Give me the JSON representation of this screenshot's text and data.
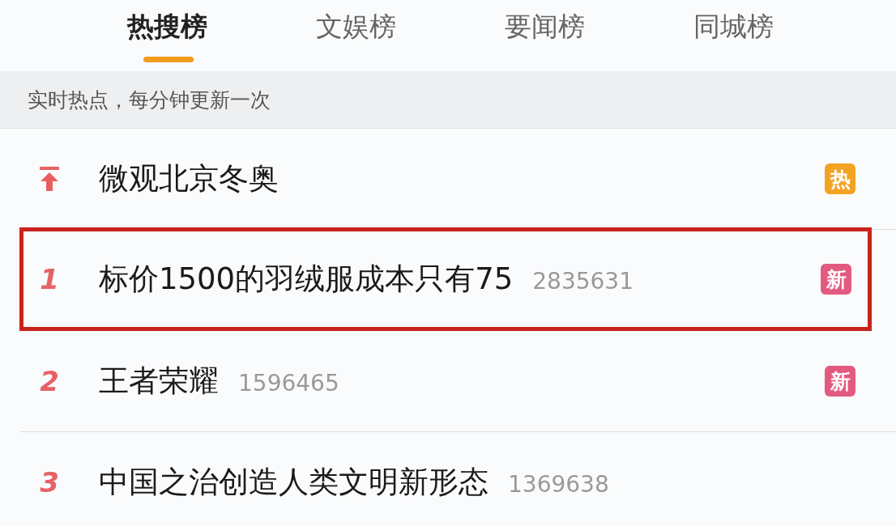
{
  "tabs": [
    {
      "label": "热搜榜",
      "selected": true
    },
    {
      "label": "文娱榜",
      "selected": false
    },
    {
      "label": "要闻榜",
      "selected": false
    },
    {
      "label": "同城榜",
      "selected": false
    }
  ],
  "notice": "实时热点，每分钟更新一次",
  "items": [
    {
      "kind": "pinned",
      "title": "微观北京冬奥",
      "badge": {
        "text": "热",
        "color": "#f3a322"
      },
      "highlighted": false
    },
    {
      "kind": "ranked",
      "rank": "1",
      "title": "标价1500的羽绒服成本只有75",
      "count": "2835631",
      "badge": {
        "text": "新",
        "color": "#e35a80"
      },
      "highlighted": true
    },
    {
      "kind": "ranked",
      "rank": "2",
      "title": "王者荣耀",
      "count": "1596465",
      "badge": {
        "text": "新",
        "color": "#e35a80"
      },
      "highlighted": false
    },
    {
      "kind": "ranked",
      "rank": "3",
      "title": "中国之治创造人类文明新形态",
      "count": "1369638",
      "highlighted": false
    }
  ]
}
